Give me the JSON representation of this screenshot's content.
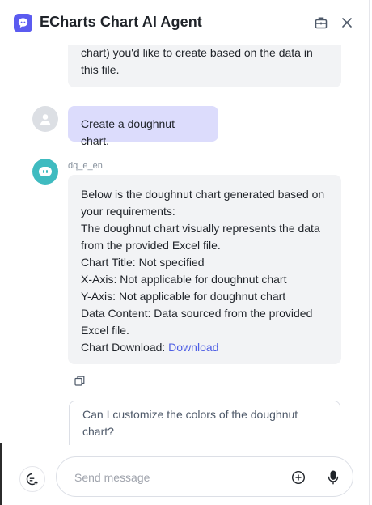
{
  "header": {
    "title": "ECharts Chart AI Agent",
    "icons": {
      "logo": "assistant-logo-icon",
      "toolbox": "toolbox-icon",
      "close": "close-icon"
    }
  },
  "messages": {
    "top_bot_text_1": "chart) you'd like to create based on the data in",
    "top_bot_text_2": "this file.",
    "user_text": "Create a doughnut chart.",
    "bot_name": "dq_e_en",
    "bot_lines": [
      "Below is the doughnut chart generated based on",
      "your requirements:",
      "The doughnut chart visually represents the data",
      "from the provided Excel file.",
      "Chart Title: Not specified",
      "X-Axis: Not applicable for doughnut chart",
      "Y-Axis: Not applicable for doughnut chart",
      "Data Content: Data sourced from the provided",
      "Excel file."
    ],
    "download_prefix": "Chart Download: ",
    "download_link": "Download"
  },
  "suggestion": {
    "line1": "Can I customize the colors of the doughnut",
    "line2": "chart?"
  },
  "composer": {
    "placeholder": "Send message"
  },
  "colors": {
    "accent": "#5b5bf0",
    "user_bubble": "#dcdcfc",
    "bot_bubble": "#f2f3f5",
    "link": "#4e5ee4",
    "bot_avatar": "#3fbbc0"
  }
}
